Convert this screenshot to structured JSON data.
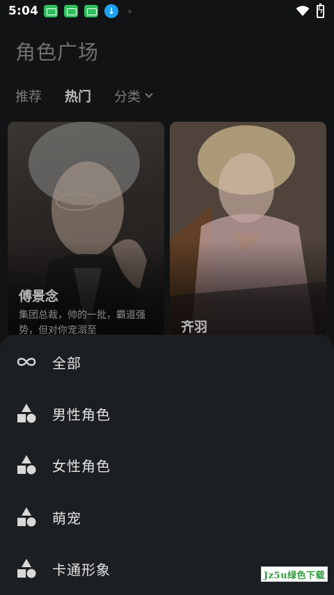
{
  "status_bar": {
    "time": "5:04",
    "icons": [
      "notification-app-icon",
      "notification-app-icon",
      "notification-app-icon",
      "download-icon",
      "dot-icon",
      "wifi-icon",
      "battery-charging-icon"
    ]
  },
  "header": {
    "title": "角色广场"
  },
  "tabs": [
    {
      "label": "推荐",
      "active": false
    },
    {
      "label": "热门",
      "active": true
    },
    {
      "label": "分类",
      "active": false,
      "icon": "chevron-down-icon"
    }
  ],
  "cards": [
    {
      "name": "傅景念",
      "description": "集团总裁，帅的一批，霸道强势，但对你宠溺至"
    },
    {
      "name": "齐羽",
      "description": ""
    }
  ],
  "category_sheet": {
    "items": [
      {
        "label": "全部",
        "icon": "infinity-icon"
      },
      {
        "label": "男性角色",
        "icon": "shapes-icon"
      },
      {
        "label": "女性角色",
        "icon": "shapes-icon"
      },
      {
        "label": "萌宠",
        "icon": "shapes-icon"
      },
      {
        "label": "卡通形象",
        "icon": "shapes-icon"
      }
    ]
  },
  "watermark": {
    "text": "Jz5u绿色下载"
  },
  "colors": {
    "background": "#121314",
    "sheet": "#1c1f22",
    "title": "#6e6f70",
    "watermark_text": "#2e9b3e"
  }
}
